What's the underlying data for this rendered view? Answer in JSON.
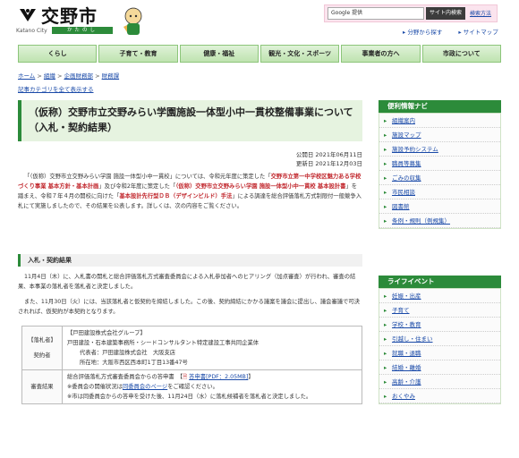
{
  "header": {
    "logo_text": "交野市",
    "logo_sub_en": "Katano City",
    "logo_sub_jp": "かたのし",
    "search_placeholder": "Google 提供",
    "search_button": "サイト内検索",
    "search_howto": "検索方法",
    "quicklinks": [
      "分野から探す",
      "サイトマップ"
    ]
  },
  "nav": [
    "くらし",
    "子育て・教育",
    "健康・福祉",
    "観光・文化・スポーツ",
    "事業者の方へ",
    "市政について"
  ],
  "breadcrumb": {
    "items": [
      "ホーム",
      "組織",
      "企画財務部",
      "財務課"
    ],
    "category_link": "記事カテゴリを全て表示する"
  },
  "page": {
    "title": "（仮称）交野市立交野みらい学園施設一体型小中一貫校整備事業について（入札・契約結果）",
    "published": "公開日 2021年06月11日",
    "updated": "更新日 2021年12月03日",
    "intro_1": "「（仮称）交野市立交野みらい学園 施設一体型小中一貫校」については、令和元年度に策定した「",
    "intro_hl_1": "交野市立第一中学校区魅力ある学校づくり事業 基本方針・基本計画",
    "intro_2": "」及び令和2年度に策定した「",
    "intro_hl_2": "（仮称）交野市立交野みらい学園 施設一体型小中一貫校 基本設計書",
    "intro_3": "」を踏まえ、令和７年４月の開校に向けた「",
    "intro_hl_3": "基本設計先行型ＤＢ（デザインビルド）手法",
    "intro_4": "」による調達を総合評価落札方式制限付一般競争入札にて実施しましたので、その結果を公表します。詳しくは、次の内容をご覧ください。",
    "section_title": "入札・契約結果",
    "para_1": "11月4日（木）に、入札書の開札と総合評価落札方式審査委員会による入札参加者へのヒアリング（加点審査）が行われ、審査の結果、本事業の落札者を落札者と決定しました。",
    "para_2": "また、11月30日（火）には、当該落札者と仮契約を締結しました。この後、契約締結にかかる議案を議会に提出し、議会審議で可決されれば、仮契約が本契約となります。",
    "table": {
      "row1_label": "【落札者】",
      "row1_label2": "契約者",
      "row1_group": "【戸田建設株式会社グループ】",
      "row1_members": "戸田建設・石本建築事務所・シードコンサルタント特定建設工事共同企業体",
      "row1_rep": "代表者：戸田建設株式会社　大阪支店",
      "row1_addr": "所在地：大阪市西区西本町1丁目13番47号",
      "row2_label": "審査結果",
      "row2_line1": "総合評価落札方式審査委員会からの答申書　【",
      "row2_pdf": "答申書[PDF：2.05MB]",
      "row2_line1_end": "】",
      "row2_line2a": "※委員会の開催状況は",
      "row2_line2_link": "同委員会のページ",
      "row2_line2b": "をご確認ください。",
      "row2_line3": "※市は同委員会からの答申を受けた後、11月24日（水）に落札候補者を落札者と決定しました。"
    }
  },
  "sidebar": {
    "nav_title": "便利情報ナビ",
    "nav_items": [
      "組織案内",
      "施設マップ",
      "施設予約システム",
      "職員等募集",
      "ごみの収集",
      "市民相談",
      "図書館",
      "条例・規則（例規集）"
    ],
    "life_title": "ライフイベント",
    "life_items": [
      "妊娠・出産",
      "子育て",
      "学校・教育",
      "引越し・住まい",
      "就職・退職",
      "結婚・離婚",
      "高齢・介護",
      "おくやみ"
    ]
  },
  "colors": {
    "accent": "#2c8b3a",
    "highlight": "#c1272d",
    "link": "#1a4aa8"
  }
}
